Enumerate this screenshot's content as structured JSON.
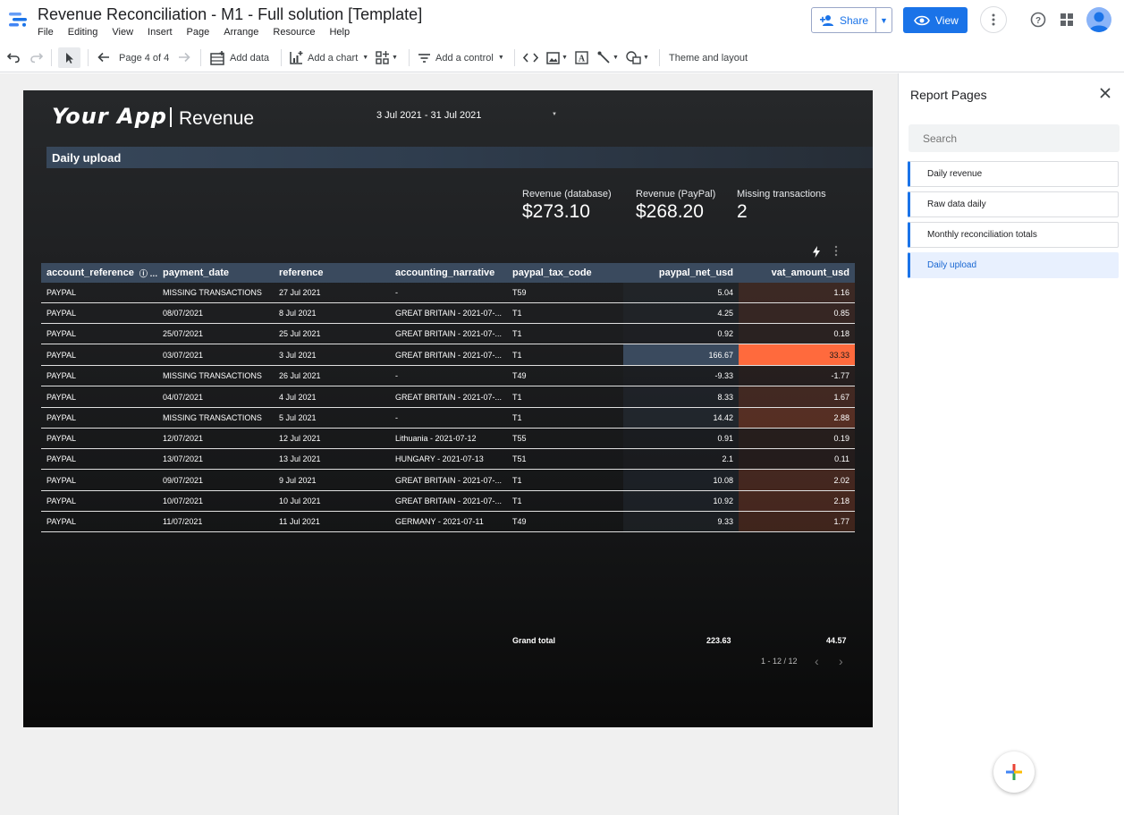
{
  "app": {
    "title": "Revenue Reconciliation - M1 - Full solution [Template]",
    "menu": [
      "File",
      "Editing",
      "View",
      "Insert",
      "Page",
      "Arrange",
      "Resource",
      "Help"
    ],
    "share_label": "Share",
    "view_label": "View"
  },
  "toolbar": {
    "page_indicator": "Page 4 of 4",
    "add_data": "Add data",
    "add_chart": "Add a chart",
    "add_control": "Add a control",
    "theme_layout": "Theme and layout"
  },
  "report": {
    "brand": "Your App",
    "brand_sub": "Revenue",
    "date_range": "3 Jul 2021 - 31 Jul 2021",
    "section_title": "Daily upload",
    "kpis": [
      {
        "label": "Revenue (database)",
        "value": "$273.10"
      },
      {
        "label": "Revenue (PayPal)",
        "value": "$268.20"
      },
      {
        "label": "Missing transactions",
        "value": "2"
      }
    ],
    "table": {
      "columns": [
        "account_reference",
        "payment_date",
        "reference",
        "accounting_narrative",
        "paypal_tax_code",
        "paypal_net_usd",
        "vat_amount_usd"
      ],
      "rows": [
        [
          "PAYPAL",
          "MISSING TRANSACTIONS",
          "27 Jul 2021",
          "-",
          "T59",
          "5.04",
          "1.16"
        ],
        [
          "PAYPAL",
          "08/07/2021",
          "8 Jul 2021",
          "GREAT BRITAIN - 2021-07-...",
          "T1",
          "4.25",
          "0.85"
        ],
        [
          "PAYPAL",
          "25/07/2021",
          "25 Jul 2021",
          "GREAT BRITAIN - 2021-07-...",
          "T1",
          "0.92",
          "0.18"
        ],
        [
          "PAYPAL",
          "03/07/2021",
          "3 Jul 2021",
          "GREAT BRITAIN - 2021-07-...",
          "T1",
          "166.67",
          "33.33"
        ],
        [
          "PAYPAL",
          "MISSING TRANSACTIONS",
          "26 Jul 2021",
          "-",
          "T49",
          "-9.33",
          "-1.77"
        ],
        [
          "PAYPAL",
          "04/07/2021",
          "4 Jul 2021",
          "GREAT BRITAIN - 2021-07-...",
          "T1",
          "8.33",
          "1.67"
        ],
        [
          "PAYPAL",
          "MISSING TRANSACTIONS",
          "5 Jul 2021",
          "-",
          "T1",
          "14.42",
          "2.88"
        ],
        [
          "PAYPAL",
          "12/07/2021",
          "12 Jul 2021",
          "Lithuania - 2021-07-12",
          "T55",
          "0.91",
          "0.19"
        ],
        [
          "PAYPAL",
          "13/07/2021",
          "13 Jul 2021",
          "HUNGARY - 2021-07-13",
          "T51",
          "2.1",
          "0.11"
        ],
        [
          "PAYPAL",
          "09/07/2021",
          "9 Jul 2021",
          "GREAT BRITAIN - 2021-07-...",
          "T1",
          "10.08",
          "2.02"
        ],
        [
          "PAYPAL",
          "10/07/2021",
          "10 Jul 2021",
          "GREAT BRITAIN - 2021-07-...",
          "T1",
          "10.92",
          "2.18"
        ],
        [
          "PAYPAL",
          "11/07/2021",
          "11 Jul 2021",
          "GERMANY - 2021-07-11",
          "T49",
          "9.33",
          "1.77"
        ]
      ],
      "grand_total_label": "Grand total",
      "grand_total_net": "223.63",
      "grand_total_vat": "44.57",
      "pagination": "1 - 12 / 12"
    }
  },
  "panel": {
    "title": "Report Pages",
    "search_placeholder": "Search",
    "pages": [
      "Daily revenue",
      "Raw data daily",
      "Monthly reconciliation totals",
      "Daily upload"
    ],
    "active_page": "Daily upload"
  },
  "colors": {
    "accent": "#1a73e8",
    "table_header": "#3a4a5e",
    "heat_blue": "#3a4a5e",
    "heat_orange": "#ff6a3d"
  }
}
